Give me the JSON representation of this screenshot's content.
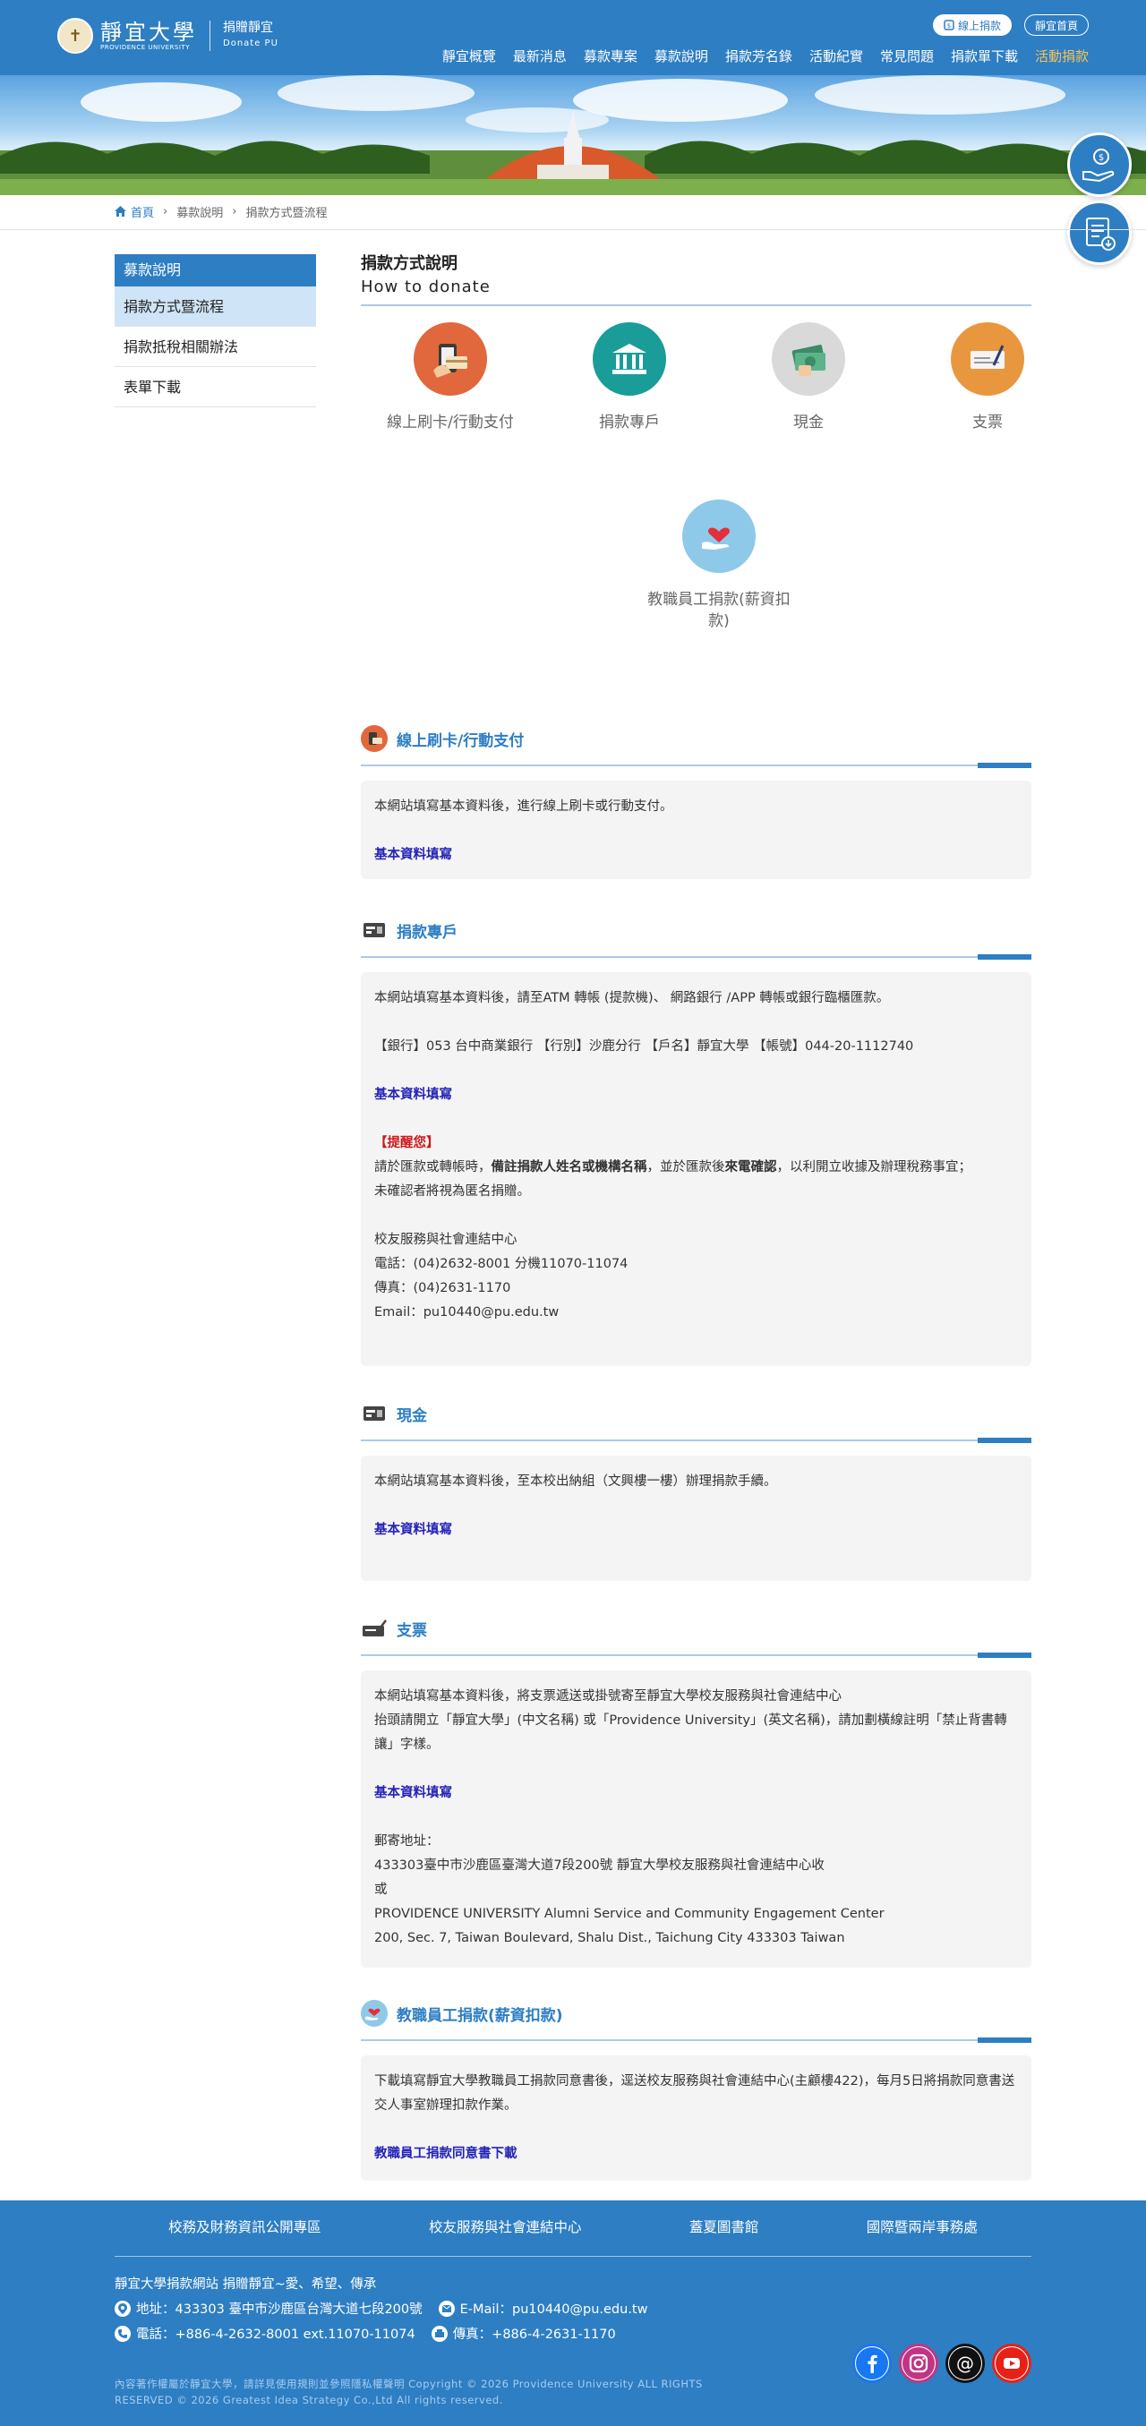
{
  "header": {
    "logo_en": "PROVIDENCE UNIVERSITY",
    "logo_cn": "靜宜大學",
    "site_name": "捐贈靜宜",
    "site_name_en": "Donate PU",
    "online_donate": "線上捐款",
    "home_btn": "靜宜首頁",
    "nav": [
      "靜宜概覽",
      "最新消息",
      "募款專案",
      "募款說明",
      "捐款芳名錄",
      "活動紀實",
      "常見問題",
      "捐款單下載",
      "活動捐款"
    ]
  },
  "breadcrumb": {
    "home": "首頁",
    "level1": "募款說明",
    "level2": "捐款方式暨流程"
  },
  "sidebar": {
    "heading": "募款說明",
    "items": [
      "捐款方式暨流程",
      "捐款抵稅相關辦法",
      "表單下載"
    ]
  },
  "main": {
    "title": "捐款方式說明",
    "title_en": "How to donate",
    "methods": [
      "線上刷卡/行動支付",
      "捐款專戶",
      "現金",
      "支票",
      "教職員工捐款(薪資扣款)"
    ]
  },
  "sections": {
    "online": {
      "title": "線上刷卡/行動支付",
      "text": "本網站填寫基本資料後，進行線上刷卡或行動支付。",
      "link": "基本資料填寫"
    },
    "account": {
      "title": "捐款專戶",
      "text": "本網站填寫基本資料後，請至ATM 轉帳 (提款機)、 網路銀行 /APP 轉帳或銀行臨櫃匯款。",
      "bank": "【銀行】053 台中商業銀行 【行別】沙鹿分行 【戶名】靜宜大學 【帳號】044-20-1112740",
      "link": "基本資料填寫",
      "reminder": "【提醒您】",
      "note_a": "請於匯款或轉帳時，",
      "note_b": "備註捐款人姓名或機構名稱",
      "note_c": "，並於匯款後",
      "note_d": "來電確認",
      "note_e": "，以利開立收據及辦理稅務事宜；",
      "note2": "未確認者將視為匿名捐贈。",
      "contact_title": "校友服務與社會連結中心",
      "phone": "電話：(04)2632-8001 分機11070-11074",
      "fax": "傳真：(04)2631-1170",
      "email": "Email：pu10440@pu.edu.tw"
    },
    "cash": {
      "title": "現金",
      "text": "本網站填寫基本資料後，至本校出納組（文興樓一樓）辦理捐款手續。",
      "link": "基本資料填寫"
    },
    "cheque": {
      "title": "支票",
      "text1": "本網站填寫基本資料後，將支票遞送或掛號寄至靜宜大學校友服務與社會連結中心",
      "text2": "抬頭請開立「靜宜大學」(中文名稱) 或「Providence University」(英文名稱)，請加劃橫線註明「禁止背書轉讓」字樣。",
      "link": "基本資料填寫",
      "mail_label": "郵寄地址：",
      "addr_cn": "433303臺中市沙鹿區臺灣大道7段200號 靜宜大學校友服務與社會連結中心收",
      "or": "或",
      "addr_en1": "PROVIDENCE UNIVERSITY Alumni Service and Community Engagement Center",
      "addr_en2": "200, Sec. 7, Taiwan Boulevard, Shalu Dist., Taichung City 433303 Taiwan"
    },
    "payroll": {
      "title": "教職員工捐款(薪資扣款)",
      "text": "下載填寫靜宜大學教職員工捐款同意書後，逕送校友服務與社會連結中心(主顧樓422)，每月5日將捐款同意書送交人事室辦理扣款作業。",
      "link": "教職員工捐款同意書下載"
    }
  },
  "footer": {
    "links": [
      "校務及財務資訊公開專區",
      "校友服務與社會連結中心",
      "蓋夏圖書館",
      "國際暨兩岸事務處"
    ],
    "site_title": "靜宜大學捐款網站 捐贈靜宜~愛、希望、傳承",
    "address": "地址：433303 臺中市沙鹿區台灣大道七段200號",
    "email": "E-Mail：pu10440@pu.edu.tw",
    "phone": "電話：+886-4-2632-8001 ext.11070-11074",
    "fax": "傳真：+886-4-2631-1170",
    "copyright": "內容著作權屬於靜宜大學，請詳見使用規則並參照隱私權聲明 Copyright © 2026 Providence University ALL RIGHTS RESERVED © 2026 Greatest Idea Strategy Co.,Ltd All rights reserved."
  },
  "colors": {
    "primary": "#2d7ec3",
    "accent": "#f7c35b",
    "link": "#2323b8",
    "warning": "#cc1a1a"
  },
  "icons": [
    "home-icon",
    "card-icon",
    "bank-icon",
    "cash-icon",
    "cheque-icon",
    "heart-hand-icon",
    "facebook-icon",
    "instagram-icon",
    "threads-icon",
    "youtube-icon"
  ]
}
